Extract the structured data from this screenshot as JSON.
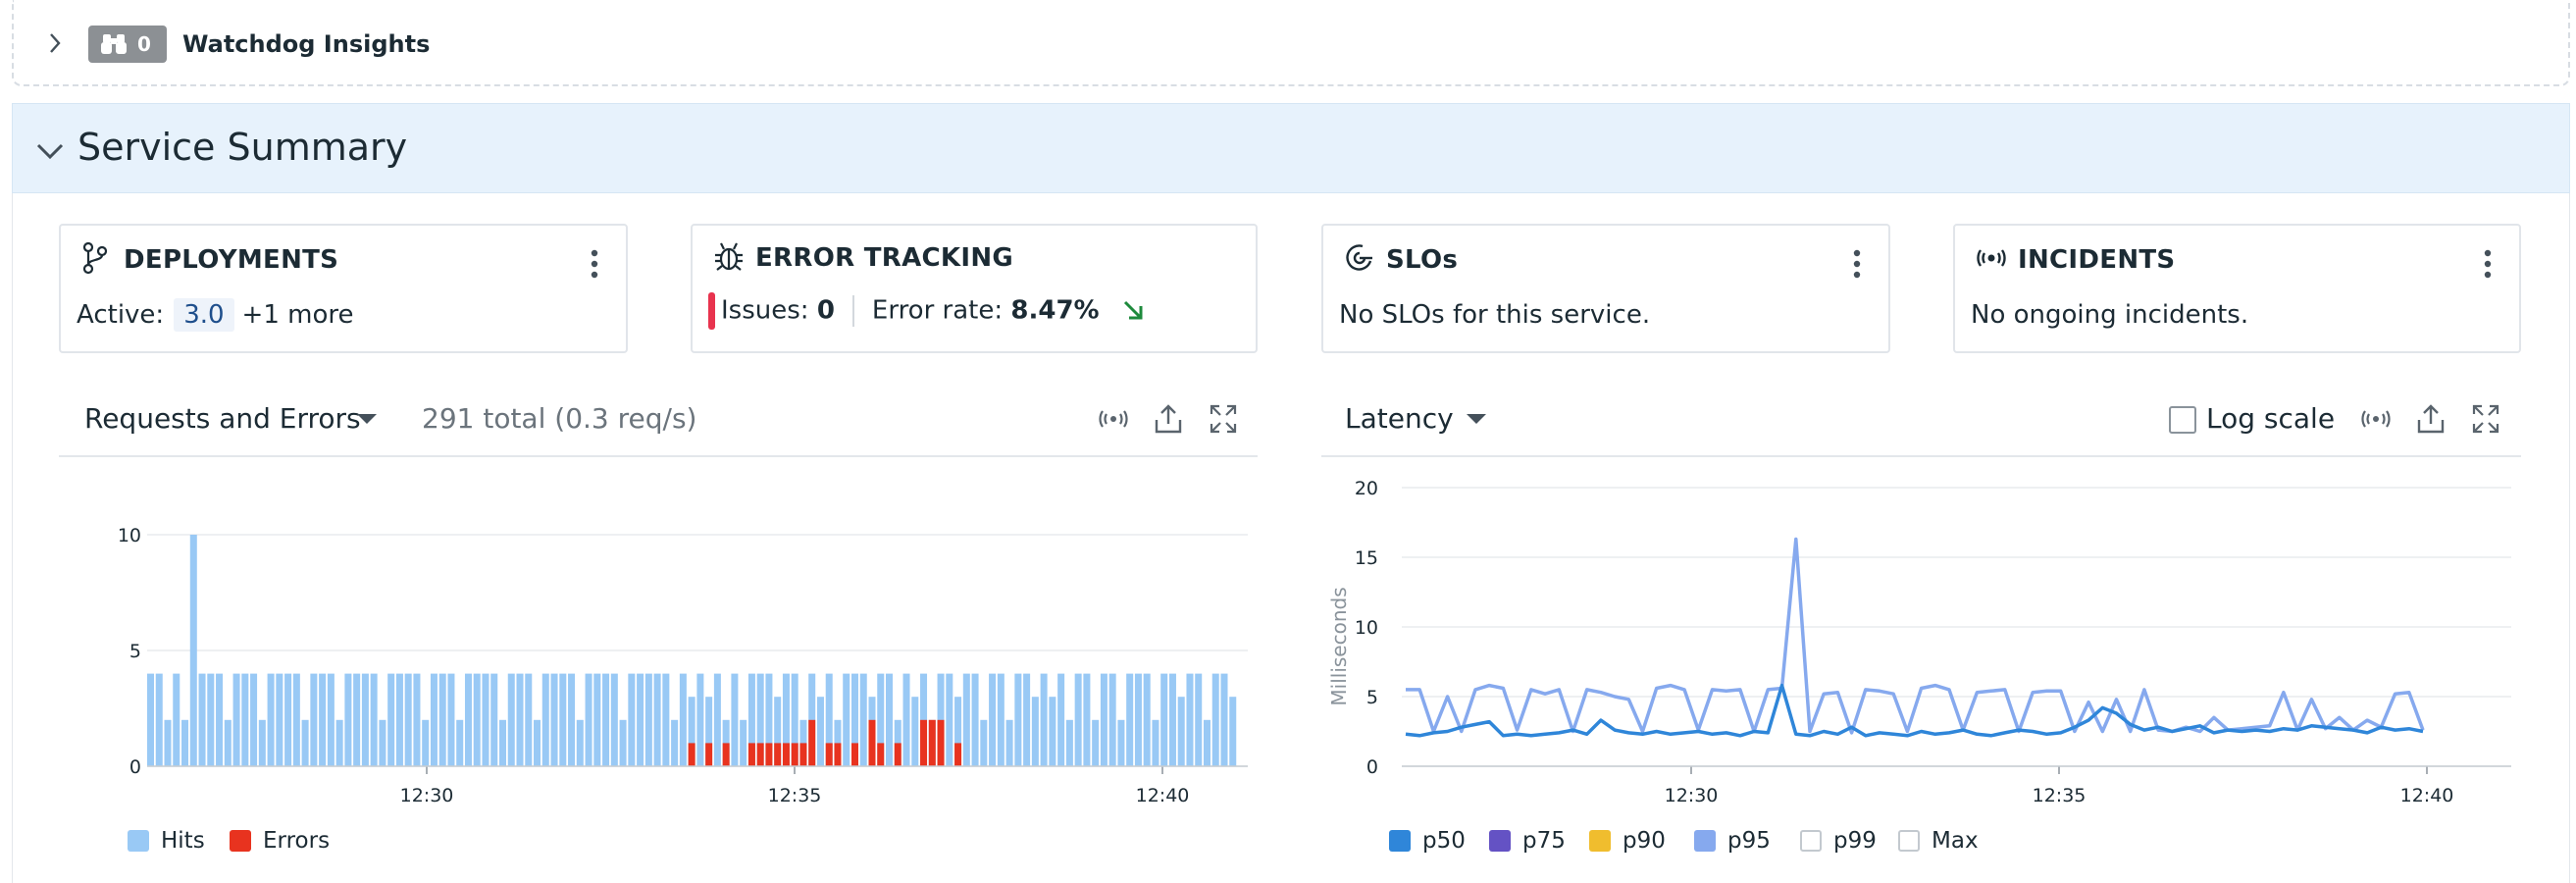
{
  "watchdog": {
    "count": "0",
    "title": "Watchdog Insights"
  },
  "summary": {
    "title": "Service Summary"
  },
  "cards": {
    "deployments": {
      "title": "DEPLOYMENTS",
      "active_label": "Active:",
      "version": "3.0",
      "more": "+1 more"
    },
    "error_tracking": {
      "title": "ERROR TRACKING",
      "issues_label": "Issues:",
      "issues_value": "0",
      "rate_label": "Error rate:",
      "rate_value": "8.47%",
      "trend": "down",
      "trend_color": "#1e8a3c"
    },
    "slos": {
      "title": "SLOs",
      "body": "No SLOs for this service."
    },
    "incidents": {
      "title": "INCIDENTS",
      "body": "No ongoing incidents."
    }
  },
  "requests_panel": {
    "selector": "Requests and Errors",
    "total": "291 total (0.3 req/s)",
    "legend": [
      {
        "label": "Hits",
        "color": "#99c9f5"
      },
      {
        "label": "Errors",
        "color": "#e8331f"
      }
    ]
  },
  "latency_panel": {
    "selector": "Latency",
    "log_scale_label": "Log scale",
    "log_scale_checked": false,
    "legend": [
      {
        "label": "p50",
        "color": "#2f86d9",
        "enabled": true
      },
      {
        "label": "p75",
        "color": "#6452c4",
        "enabled": true
      },
      {
        "label": "p90",
        "color": "#f0bd2e",
        "enabled": true
      },
      {
        "label": "p95",
        "color": "#86a9ee",
        "enabled": true
      },
      {
        "label": "p99",
        "color": "#ffffff",
        "enabled": false
      },
      {
        "label": "Max",
        "color": "#ffffff",
        "enabled": false
      }
    ]
  },
  "chart_data": [
    {
      "type": "bar",
      "stacked": true,
      "title": "",
      "yticks": [
        0,
        5,
        10
      ],
      "ylim": [
        0,
        10
      ],
      "xticks": [
        "12:30",
        "12:35",
        "12:40"
      ],
      "grid": true,
      "legend_position": "bottom-left",
      "series": [
        {
          "name": "Hits",
          "color": "#99c9f5",
          "values": [
            4,
            4,
            2,
            4,
            2,
            10,
            4,
            4,
            4,
            2,
            4,
            4,
            4,
            2,
            4,
            4,
            4,
            4,
            2,
            4,
            4,
            4,
            2,
            4,
            4,
            4,
            4,
            2,
            4,
            4,
            4,
            4,
            2,
            4,
            4,
            4,
            2,
            4,
            4,
            4,
            4,
            2,
            4,
            4,
            4,
            2,
            4,
            4,
            4,
            4,
            2,
            4,
            4,
            4,
            4,
            2,
            4,
            4,
            4,
            4,
            4,
            2,
            4,
            3,
            4,
            3,
            4,
            2,
            4,
            2,
            4,
            4,
            4,
            3,
            4,
            4,
            2,
            4,
            3,
            4,
            2,
            4,
            4,
            4,
            3,
            4,
            4,
            2,
            4,
            3,
            4,
            2,
            4,
            4,
            3,
            4,
            4,
            2,
            4,
            4,
            2,
            4,
            4,
            3,
            4,
            3,
            4,
            2,
            4,
            4,
            2,
            4,
            4,
            2,
            4,
            4,
            4,
            2,
            4,
            4,
            3,
            4,
            4,
            2,
            4,
            4,
            3
          ]
        },
        {
          "name": "Errors",
          "color": "#e8331f",
          "values": [
            0,
            0,
            0,
            0,
            0,
            0,
            0,
            0,
            0,
            0,
            0,
            0,
            0,
            0,
            0,
            0,
            0,
            0,
            0,
            0,
            0,
            0,
            0,
            0,
            0,
            0,
            0,
            0,
            0,
            0,
            0,
            0,
            0,
            0,
            0,
            0,
            0,
            0,
            0,
            0,
            0,
            0,
            0,
            0,
            0,
            0,
            0,
            0,
            0,
            0,
            0,
            0,
            0,
            0,
            0,
            0,
            0,
            0,
            0,
            0,
            0,
            0,
            0,
            1,
            0,
            1,
            0,
            1,
            0,
            0,
            1,
            1,
            1,
            1,
            1,
            1,
            1,
            2,
            0,
            1,
            1,
            0,
            1,
            0,
            2,
            1,
            0,
            1,
            0,
            0,
            2,
            2,
            2,
            0,
            1
          ]
        }
      ]
    },
    {
      "type": "line",
      "title": "",
      "ylabel": "Milliseconds",
      "yticks": [
        0,
        5,
        10,
        15,
        20
      ],
      "ylim": [
        0,
        20
      ],
      "xticks": [
        "12:30",
        "12:35",
        "12:40"
      ],
      "grid": true,
      "legend_position": "bottom-left",
      "series": [
        {
          "name": "p50",
          "color": "#2f86d9",
          "values": [
            2.3,
            2.2,
            2.4,
            2.5,
            2.8,
            3.0,
            3.2,
            2.2,
            2.3,
            2.2,
            2.3,
            2.4,
            2.6,
            2.3,
            3.3,
            2.6,
            2.4,
            2.3,
            2.5,
            2.3,
            2.4,
            2.5,
            2.3,
            2.4,
            2.2,
            2.5,
            2.4,
            5.8,
            2.3,
            2.2,
            2.5,
            2.3,
            2.8,
            2.2,
            2.4,
            2.3,
            2.2,
            2.5,
            2.3,
            2.4,
            2.6,
            2.3,
            2.2,
            2.4,
            2.6,
            2.5,
            2.3,
            2.4,
            2.8,
            3.3,
            4.2,
            3.8,
            3.0,
            2.6,
            2.8,
            2.5,
            2.7,
            2.9,
            2.4,
            2.6,
            2.5,
            2.6,
            2.5,
            2.7,
            2.6,
            2.9,
            2.8,
            2.7,
            2.6,
            2.4,
            2.8,
            2.6,
            2.7,
            2.5
          ]
        },
        {
          "name": "p95",
          "color": "#86a9ee",
          "values": [
            5.5,
            5.5,
            2.5,
            5.0,
            2.5,
            5.5,
            5.8,
            5.6,
            2.6,
            5.5,
            5.2,
            5.5,
            2.5,
            5.5,
            5.3,
            5.0,
            4.8,
            2.5,
            5.6,
            5.8,
            5.5,
            2.6,
            5.5,
            5.4,
            5.5,
            2.5,
            5.5,
            5.6,
            16.3,
            2.5,
            5.2,
            5.3,
            2.4,
            5.5,
            5.4,
            5.2,
            2.5,
            5.6,
            5.8,
            5.5,
            2.6,
            5.3,
            5.4,
            5.5,
            2.5,
            5.3,
            5.4,
            5.4,
            2.5,
            4.6,
            2.5,
            4.8,
            2.5,
            5.5,
            2.6,
            2.5,
            2.8,
            2.5,
            3.5,
            2.6,
            2.7,
            2.8,
            2.9,
            5.3,
            2.6,
            4.8,
            2.7,
            3.5,
            2.6,
            3.3,
            2.8,
            5.2,
            5.3,
            2.6
          ]
        }
      ]
    }
  ]
}
